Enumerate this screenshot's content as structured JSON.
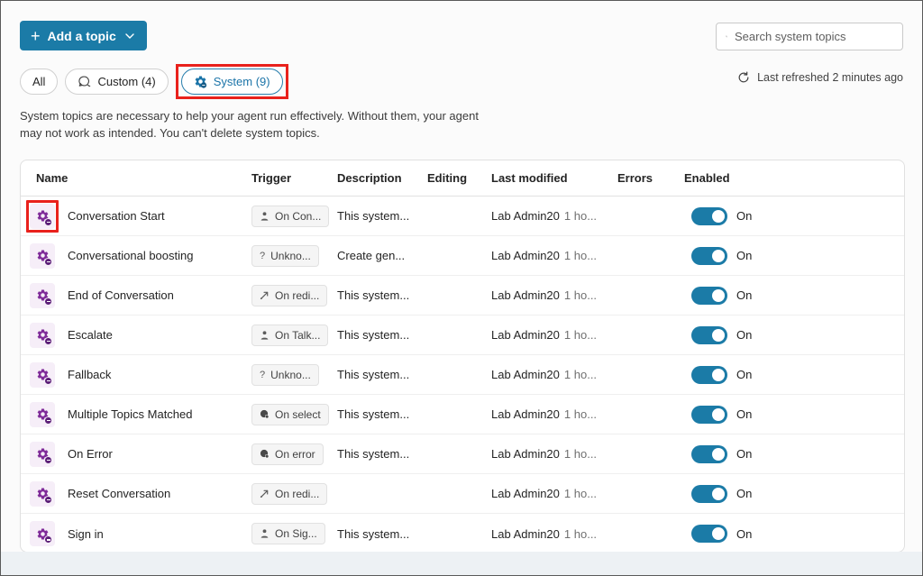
{
  "colors": {
    "accent": "#1b7ba7",
    "annotation_red": "#e9211c",
    "topic_icon_purple": "#7f2b99",
    "topic_icon_bg": "#f6eef8"
  },
  "toolbar": {
    "add_topic_label": "Add a topic",
    "search_placeholder": "Search system topics",
    "refresh_label": "Last refreshed 2 minutes ago"
  },
  "filters": [
    {
      "label": "All",
      "selected": false
    },
    {
      "label": "Custom (4)",
      "icon": "chat-icon",
      "selected": false
    },
    {
      "label": "System (9)",
      "icon": "system-gear-icon",
      "selected": true,
      "annotated": true
    }
  ],
  "description": {
    "line1": "System topics are necessary to help your agent run effectively. Without them, your agent",
    "line2": "may not work as intended. You can't delete system topics."
  },
  "table": {
    "columns": [
      "Name",
      "Trigger",
      "Description",
      "Editing",
      "Last modified",
      "Errors",
      "Enabled"
    ],
    "rows": [
      {
        "name": "Conversation Start",
        "trigger_icon": "person",
        "trigger": "On Con...",
        "description": "This system...",
        "editing": "",
        "modified_by": "Lab Admin20",
        "modified_time": "1 ho...",
        "errors": "",
        "enabled": true,
        "enabled_label": "On",
        "icon_annotated": true
      },
      {
        "name": "Conversational boosting",
        "trigger_icon": "question",
        "trigger": "Unkno...",
        "description": "Create gen...",
        "editing": "",
        "modified_by": "Lab Admin20",
        "modified_time": "1 ho...",
        "errors": "",
        "enabled": true,
        "enabled_label": "On",
        "icon_annotated": false
      },
      {
        "name": "End of Conversation",
        "trigger_icon": "redirect",
        "trigger": "On redi...",
        "description": "This system...",
        "editing": "",
        "modified_by": "Lab Admin20",
        "modified_time": "1 ho...",
        "errors": "",
        "enabled": true,
        "enabled_label": "On",
        "icon_annotated": false
      },
      {
        "name": "Escalate",
        "trigger_icon": "person",
        "trigger": "On Talk...",
        "description": "This system...",
        "editing": "",
        "modified_by": "Lab Admin20",
        "modified_time": "1 ho...",
        "errors": "",
        "enabled": true,
        "enabled_label": "On",
        "icon_annotated": false
      },
      {
        "name": "Fallback",
        "trigger_icon": "question",
        "trigger": "Unkno...",
        "description": "This system...",
        "editing": "",
        "modified_by": "Lab Admin20",
        "modified_time": "1 ho...",
        "errors": "",
        "enabled": true,
        "enabled_label": "On",
        "icon_annotated": false
      },
      {
        "name": "Multiple Topics Matched",
        "trigger_icon": "event",
        "trigger": "On select",
        "description": "This system...",
        "editing": "",
        "modified_by": "Lab Admin20",
        "modified_time": "1 ho...",
        "errors": "",
        "enabled": true,
        "enabled_label": "On",
        "icon_annotated": false
      },
      {
        "name": "On Error",
        "trigger_icon": "event",
        "trigger": "On error",
        "description": "This system...",
        "editing": "",
        "modified_by": "Lab Admin20",
        "modified_time": "1 ho...",
        "errors": "",
        "enabled": true,
        "enabled_label": "On",
        "icon_annotated": false
      },
      {
        "name": "Reset Conversation",
        "trigger_icon": "redirect",
        "trigger": "On redi...",
        "description": "",
        "editing": "",
        "modified_by": "Lab Admin20",
        "modified_time": "1 ho...",
        "errors": "",
        "enabled": true,
        "enabled_label": "On",
        "icon_annotated": false
      },
      {
        "name": "Sign in",
        "trigger_icon": "person",
        "trigger": "On Sig...",
        "description": "This system...",
        "editing": "",
        "modified_by": "Lab Admin20",
        "modified_time": "1 ho...",
        "errors": "",
        "enabled": true,
        "enabled_label": "On",
        "icon_annotated": false
      }
    ]
  }
}
